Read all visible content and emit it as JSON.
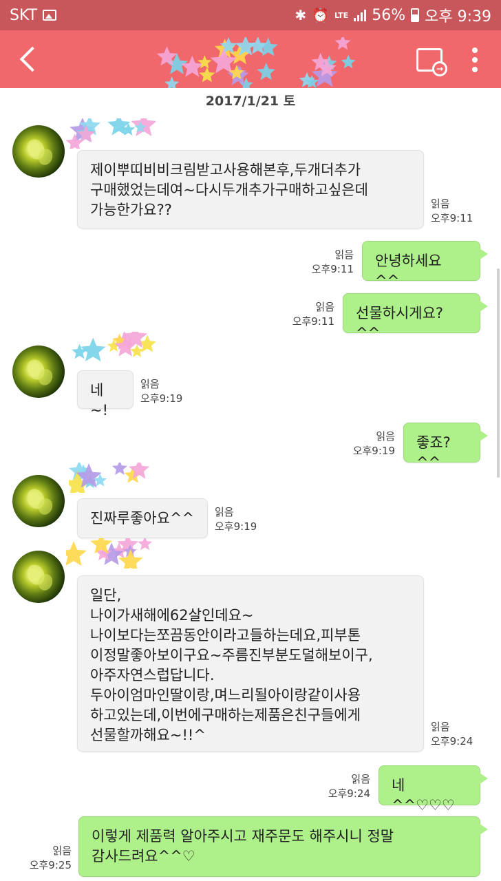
{
  "status_bar": {
    "carrier": "SKT",
    "lte": "LTE",
    "battery": "56%",
    "time": "오후 9:39"
  },
  "date_divider": "2017/1/21 토",
  "messages": [
    {
      "direction": "in",
      "text": "제이뿌띠비비크림받고사용해본후,두개더추가\n구매했었는데여~다시두개추가구매하고싶은데\n가능한가요??",
      "read": "읽음",
      "time": "오후9:11"
    },
    {
      "direction": "out",
      "text": "안녕하세요 ^^",
      "read": "읽음",
      "time": "오후9:11"
    },
    {
      "direction": "out",
      "text": "선물하시게요?^^",
      "read": "읽음",
      "time": "오후9:11"
    },
    {
      "direction": "in",
      "text": "네~!",
      "read": "읽음",
      "time": "오후9:19"
    },
    {
      "direction": "out",
      "text": "좋죠?^^",
      "read": "읽음",
      "time": "오후9:19"
    },
    {
      "direction": "in",
      "text": "진짜루좋아요^^",
      "read": "읽음",
      "time": "오후9:19"
    },
    {
      "direction": "in",
      "text": "일단,\n나이가새해에62살인데요~\n나이보다는쪼끔동안이라고들하는데요,피부톤\n이정말좋아보이구요~주름진부분도덜해보이구,\n아주자연스럽답니다.\n두아이엄마인딸이랑,며느리될아이랑같이사용\n하고있는데,이번에구매하는제품은친구들에게\n선물할까해요~!!^",
      "read": "읽음",
      "time": "오후9:24"
    },
    {
      "direction": "out",
      "text": "네^^♡♡♡",
      "read": "읽음",
      "time": "오후9:24"
    },
    {
      "direction": "out",
      "text": "이렇게 제품력 알아주시고 재주문도 해주시니 정말\n감사드려요^^♡",
      "read": "읽음",
      "time": "오후9:25"
    }
  ],
  "colors": {
    "header": "#f0686b",
    "status_bar": "#c8575c",
    "outgoing_bubble": "#aef08a",
    "incoming_bubble": "#f2f2f2"
  },
  "icons": [
    "back-arrow-icon",
    "export-icon",
    "more-vert-icon",
    "bluetooth-icon",
    "alarm-icon",
    "signal-icon",
    "battery-icon",
    "image-icon"
  ]
}
